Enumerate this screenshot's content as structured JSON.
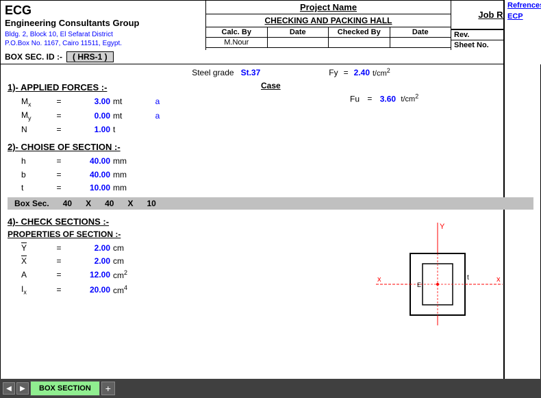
{
  "header": {
    "ecg_title": "ECG",
    "ecg_full": "Engineering Consultants Group",
    "ecg_address": "Bldg. 2, Block 10, El Sefarat District",
    "ecg_pobox": "P.O.Box No. 1167, Cairo 11511, Egypt.",
    "project_name_label": "Project Name",
    "project_title": "CHECKING AND PACKING HALL",
    "calc_by_label": "Calc. By",
    "date_label": "Date",
    "checked_by_label": "Checked By",
    "date2_label": "Date",
    "calc_by_value": "M.Nour",
    "rev_label": "Rev.",
    "sheet_no_label": "Sheet No.",
    "job_ref_label": "Job Ref."
  },
  "box_sec": {
    "label": "BOX SEC. ID :-",
    "value": "( HRS-1 )"
  },
  "references": {
    "title": "Refrences",
    "ecp": "ECP"
  },
  "steel_grade": {
    "label": "Steel grade",
    "value": "St.37"
  },
  "section1": {
    "title": "1)- APPLIED FORCES :-",
    "case_label": "Case",
    "forces": [
      {
        "name": "Mx",
        "sub": "x",
        "eq": "=",
        "val": "3.00",
        "unit": "mt",
        "case": "a"
      },
      {
        "name": "My",
        "sub": "y",
        "eq": "=",
        "val": "0.00",
        "unit": "mt",
        "case": "a"
      },
      {
        "name": "N",
        "sub": "",
        "eq": "=",
        "val": "1.00",
        "unit": "t",
        "case": ""
      }
    ],
    "fy_label": "Fy",
    "fy_eq": "=",
    "fy_val": "2.40",
    "fy_unit": "t/cm²",
    "fu_label": "Fu",
    "fu_eq": "=",
    "fu_val": "3.60",
    "fu_unit": "t/cm²"
  },
  "section2": {
    "title": "2)- CHOISE OF SECTION :-",
    "dims": [
      {
        "name": "h",
        "eq": "=",
        "val": "40.00",
        "unit": "mm"
      },
      {
        "name": "b",
        "eq": "=",
        "val": "40.00",
        "unit": "mm"
      },
      {
        "name": "t",
        "eq": "=",
        "val": "10.00",
        "unit": "mm"
      }
    ],
    "box_label": "Box Sec.",
    "box_h": "40",
    "box_x1": "X",
    "box_b": "40",
    "box_x2": "X",
    "box_t": "10"
  },
  "section4": {
    "title": "4)- CHECK SECTIONS :-",
    "props_title": "PROPERTIES OF SECTION :-",
    "props": [
      {
        "name": "Y̅",
        "over": true,
        "eq": "=",
        "val": "2.00",
        "unit": "cm"
      },
      {
        "name": "X̅",
        "over": true,
        "eq": "=",
        "val": "2.00",
        "unit": "cm"
      },
      {
        "name": "A",
        "eq": "=",
        "val": "12.00",
        "unit": "cm²"
      },
      {
        "name": "Ix",
        "sub": "x",
        "eq": "=",
        "val": "20.00",
        "unit": "cm⁴"
      }
    ]
  },
  "tab_bar": {
    "active_tab": "BOX SECTION",
    "nav_prev": "◀",
    "nav_next": "▶",
    "add_tab": "+"
  }
}
